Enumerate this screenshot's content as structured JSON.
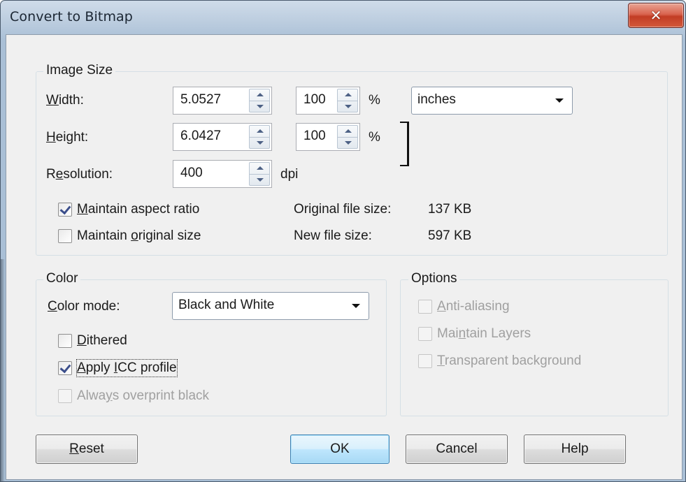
{
  "window": {
    "title": "Convert to Bitmap",
    "close_icon": "close-icon"
  },
  "image_size": {
    "group_title": "Image Size",
    "width": {
      "label_pre": "",
      "label_key": "W",
      "label_post": "idth:",
      "value": "5.0527",
      "percent": "100",
      "percent_sign": "%"
    },
    "height": {
      "label_pre": "",
      "label_key": "H",
      "label_post": "eight:",
      "value": "6.0427",
      "percent": "100",
      "percent_sign": "%"
    },
    "resolution": {
      "label_pre": "R",
      "label_key": "e",
      "label_post": "solution:",
      "value": "400",
      "unit": "dpi"
    },
    "units": {
      "selected": "inches"
    },
    "maintain_aspect": {
      "label_pre": "",
      "label_key": "M",
      "label_post": "aintain aspect ratio",
      "checked": true
    },
    "maintain_original": {
      "label_pre": "Maintain ",
      "label_key": "o",
      "label_post": "riginal size",
      "checked": false
    },
    "original_file_size": {
      "label": "Original file size:",
      "value": "137 KB"
    },
    "new_file_size": {
      "label": "New file size:",
      "value": "597 KB"
    }
  },
  "color": {
    "group_title": "Color",
    "mode": {
      "label_pre": "",
      "label_key": "C",
      "label_post": "olor mode:",
      "selected": "Black and White"
    },
    "dithered": {
      "label_pre": "",
      "label_key": "D",
      "label_post": "ithered",
      "checked": false
    },
    "apply_icc": {
      "label_pre": "",
      "label_key": "A",
      "label_post": "pply ",
      "label_key2": "I",
      "label_post2": "CC profile",
      "checked": true
    },
    "overprint": {
      "label_pre": "Alwa",
      "label_key": "y",
      "label_post": "s overprint black",
      "checked": false,
      "disabled": true
    }
  },
  "options": {
    "group_title": "Options",
    "anti_aliasing": {
      "label_pre": "",
      "label_key": "A",
      "label_post": "nti-aliasing",
      "checked": false,
      "disabled": true
    },
    "maintain_layers": {
      "label_pre": "Mai",
      "label_key": "n",
      "label_post": "tain Layers",
      "checked": false,
      "disabled": true
    },
    "transparent_bg": {
      "label_pre": "",
      "label_key": "T",
      "label_post": "ransparent background",
      "checked": false,
      "disabled": true
    }
  },
  "buttons": {
    "reset": {
      "label_key": "R",
      "label_post": "eset"
    },
    "ok": "OK",
    "cancel": "Cancel",
    "help": "Help"
  },
  "colors": {
    "dialog_bg": "#f0f0f0",
    "frame_blue": "#bccddf",
    "close_red": "#c23c24",
    "default_button_blue": "#3c7fb1",
    "check_mark": "#3b4e8b"
  }
}
